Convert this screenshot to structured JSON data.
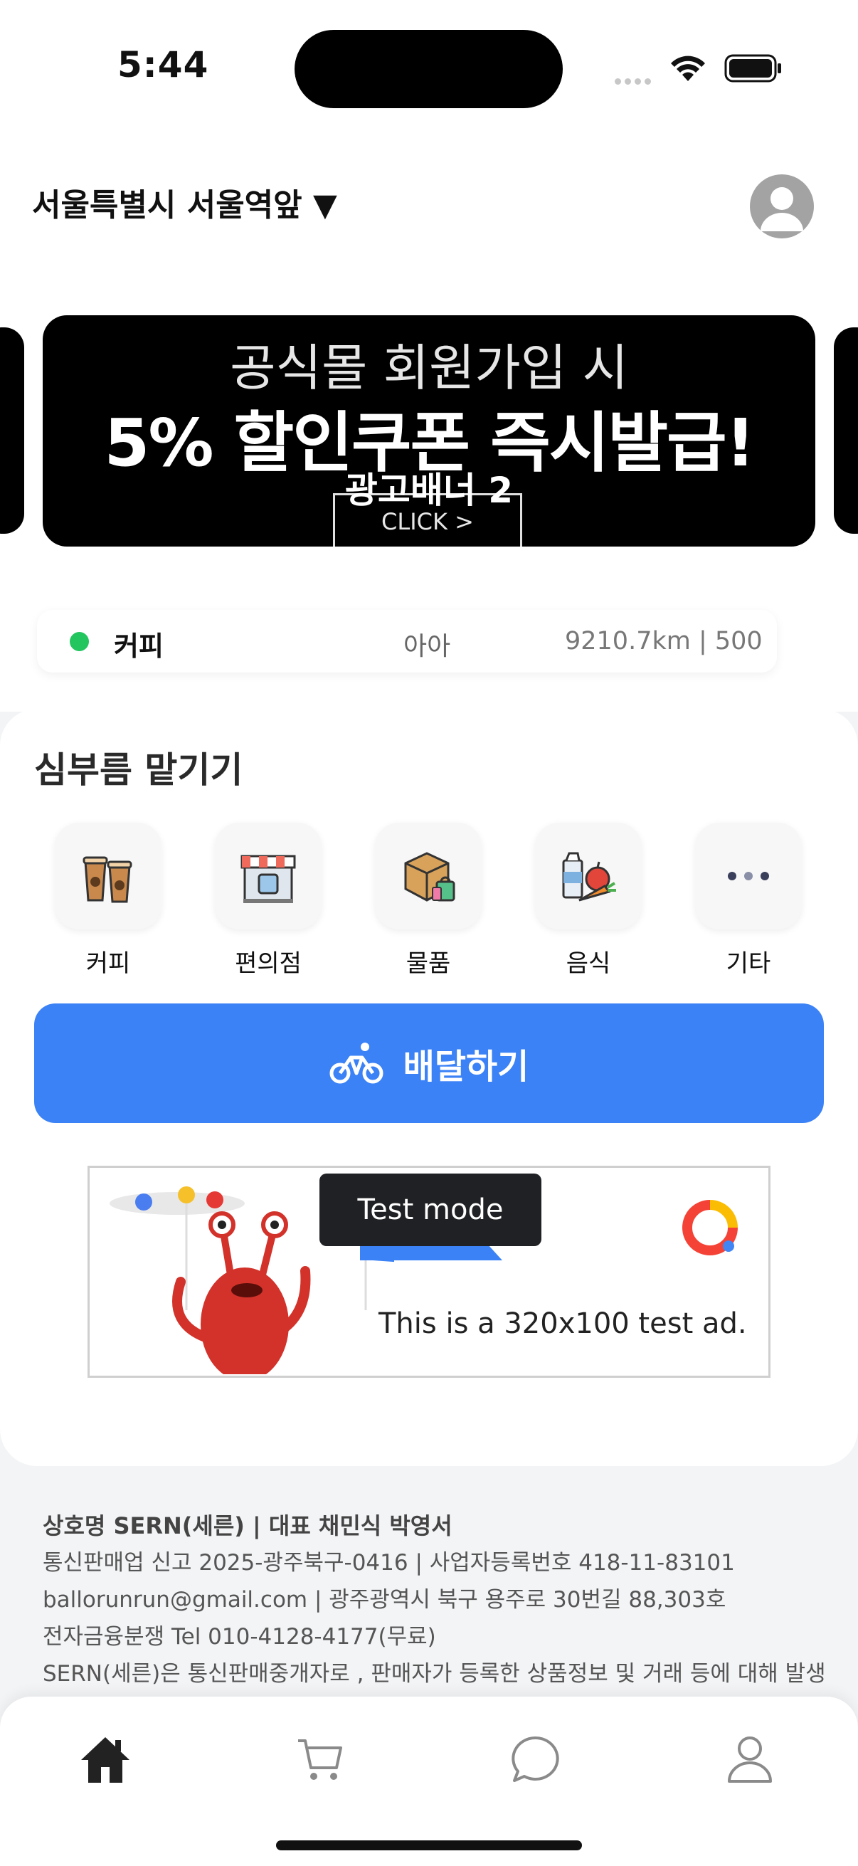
{
  "status_bar": {
    "time": "5:44"
  },
  "header": {
    "location": "서울특별시 서울역앞 ▼"
  },
  "banner": {
    "line1": "공식몰 회원가입 시",
    "line2": "5% 할인쿠폰 즉시발급!",
    "label": "광고배너 2",
    "click": "CLICK >"
  },
  "status_strip": {
    "name": "커피",
    "middle": "아아",
    "distance": "9210.7km | 500"
  },
  "errand": {
    "title": "심부름 맡기기",
    "categories": [
      {
        "label": "커피",
        "icon": "coffee-cups-icon"
      },
      {
        "label": "편의점",
        "icon": "convenience-store-icon"
      },
      {
        "label": "물품",
        "icon": "package-icon"
      },
      {
        "label": "음식",
        "icon": "grocery-food-icon"
      },
      {
        "label": "기타",
        "icon": "more-dots-icon"
      }
    ],
    "deliver_label": "배달하기"
  },
  "ad": {
    "badge": "Test mode",
    "text": "This is a 320x100 test ad."
  },
  "footer": {
    "line1": "상호명 SERN(세른) | 대표 채민식 박영서",
    "line2": "통신판매업 신고 2025-광주북구-0416 | 사업자등록번호 418-11-83101",
    "line3": "ballorunrun@gmail.com | 광주광역시 북구 용주로 30번길 88,303호",
    "line4": "전자금융분쟁 Tel 010-4128-4177(무료)",
    "line5": "SERN(세른)은 통신판매중개자로 , 판매자가 등록한 상품정보 및 거래 등에 대해 발생"
  },
  "bottom_nav": [
    "home-icon",
    "cart-icon",
    "chat-icon",
    "profile-icon"
  ],
  "colors": {
    "accent": "#3b82f6",
    "status_green": "#22c55e"
  }
}
